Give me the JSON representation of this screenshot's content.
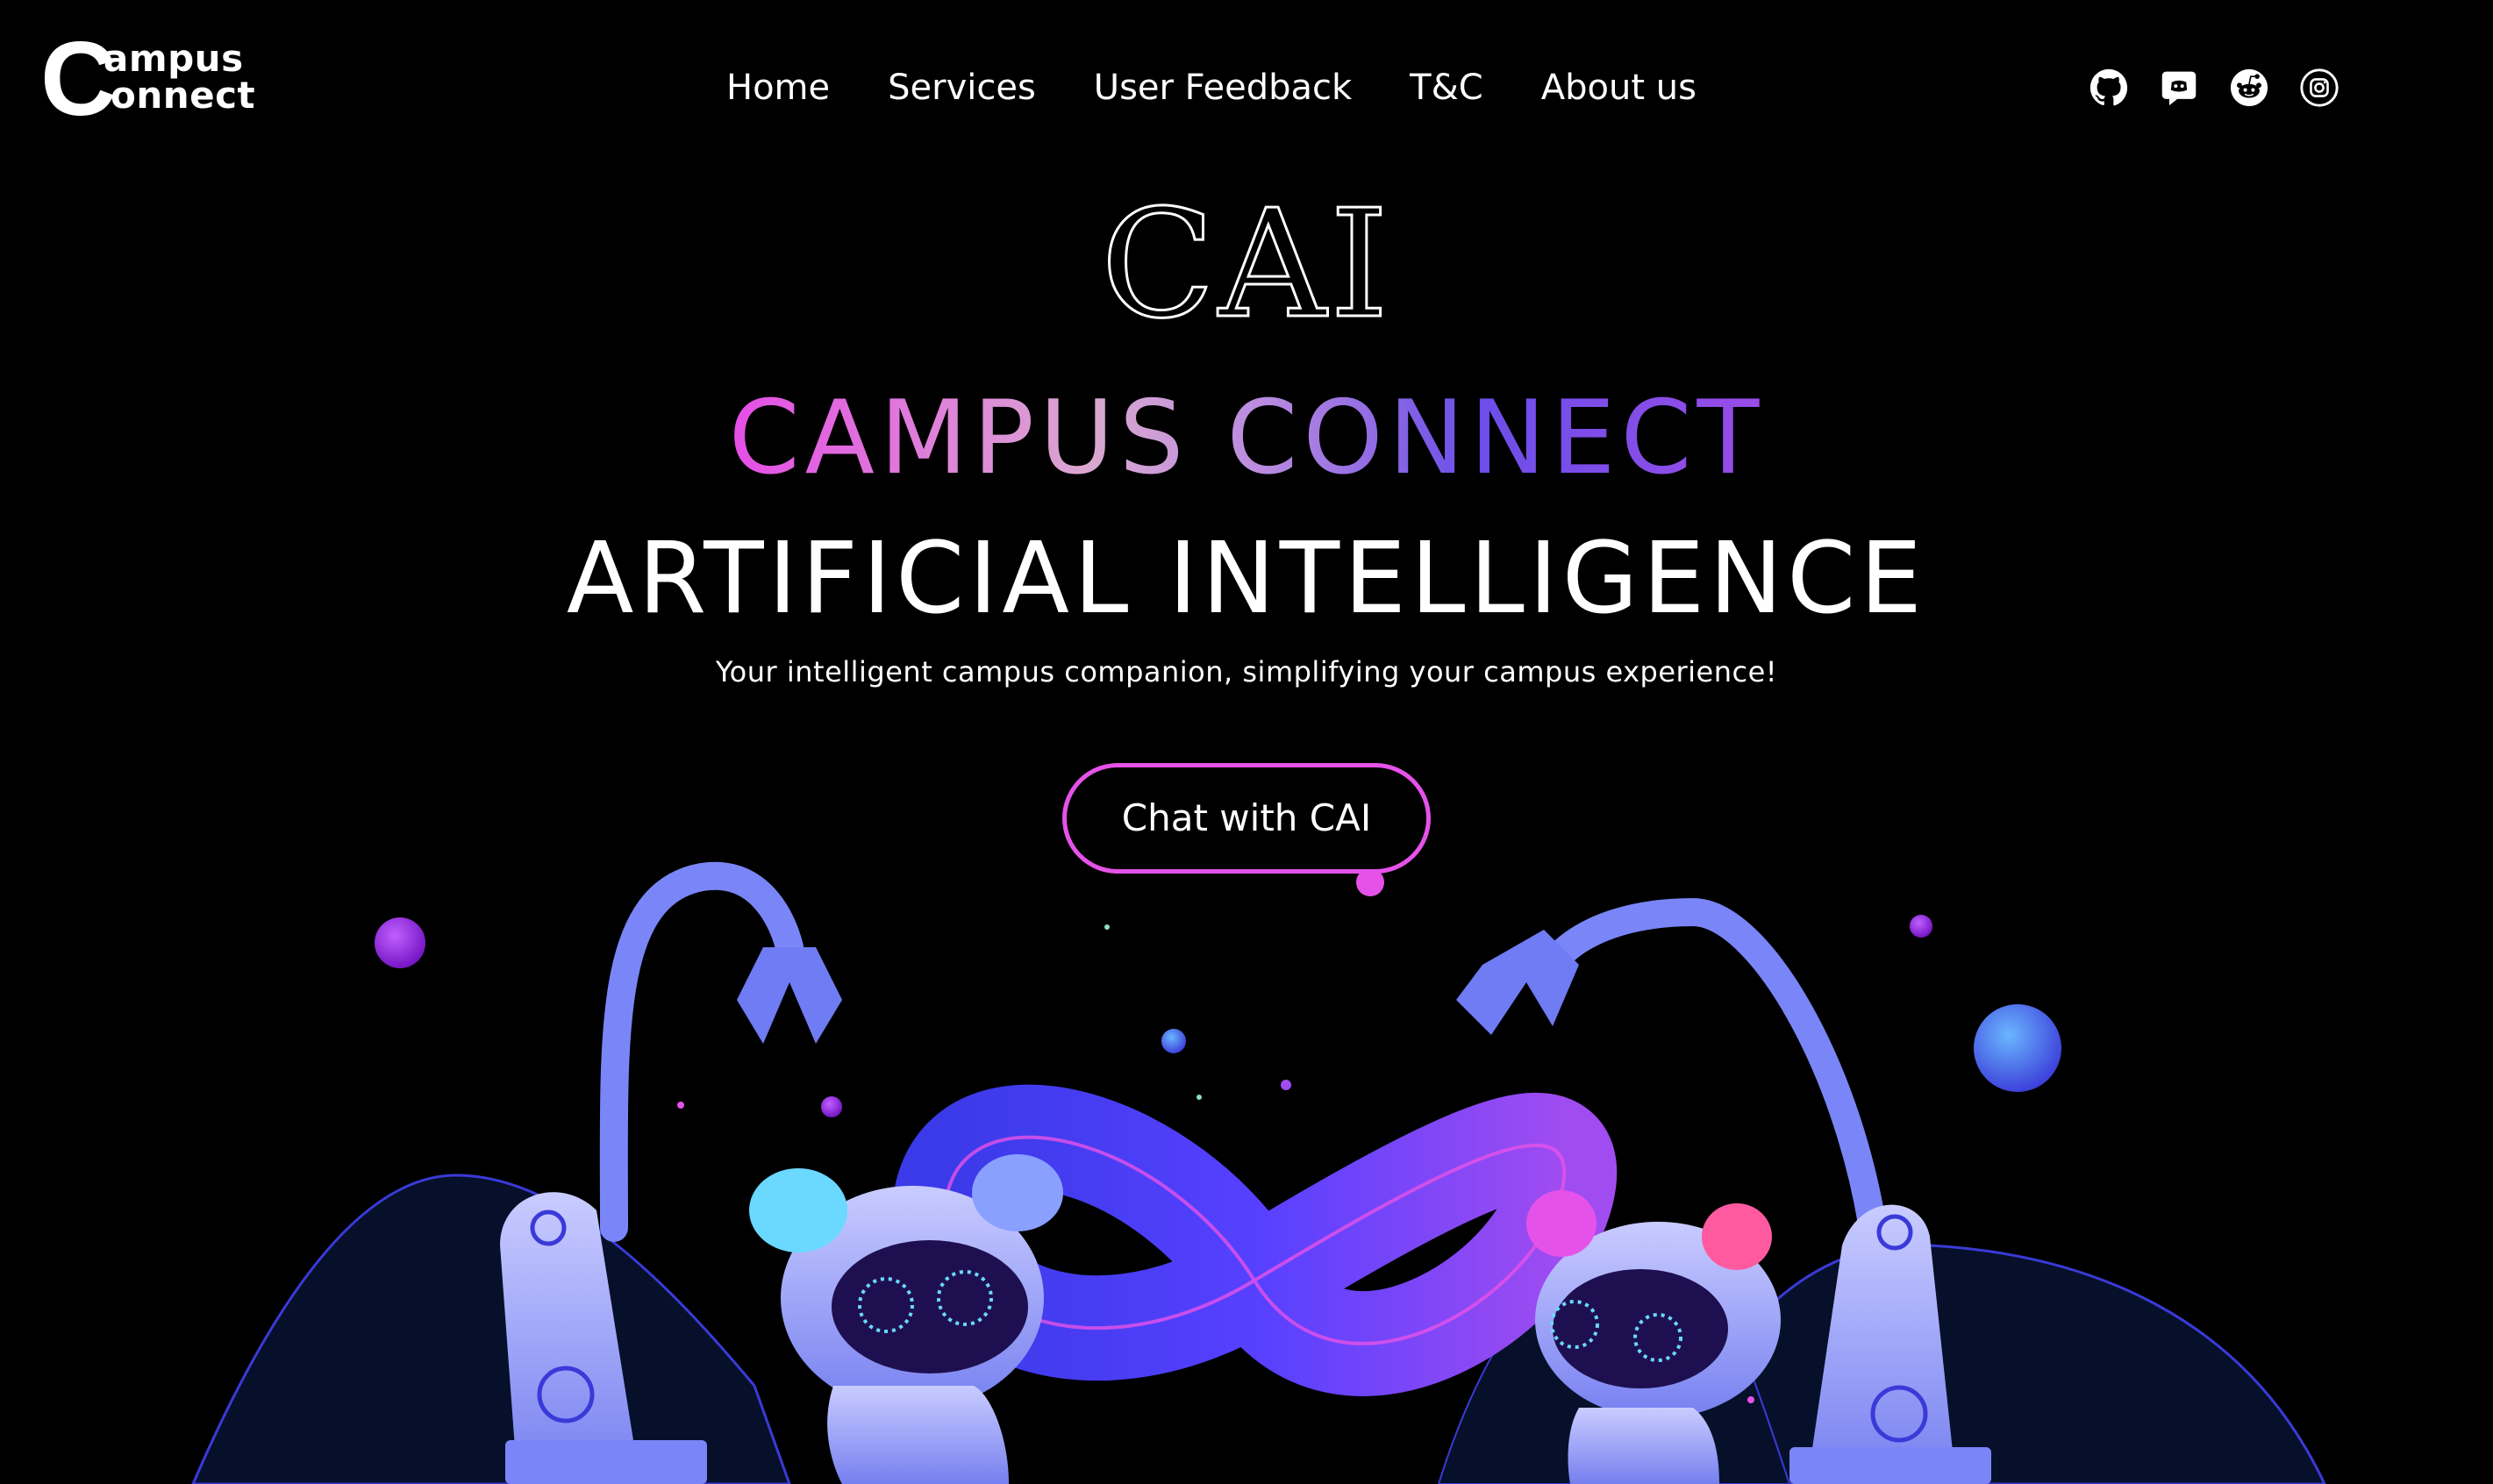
{
  "header": {
    "logo": {
      "big_letter": "C",
      "line1": "ampus",
      "line2": "onnect"
    },
    "nav": [
      "Home",
      "Services",
      "User Feedback",
      "T&C",
      "About us"
    ],
    "socials": [
      "github-icon",
      "discord-icon",
      "reddit-icon",
      "instagram-icon"
    ]
  },
  "hero": {
    "logo_text": "CAI",
    "title_gradient": "CAMPUS CONNECT",
    "subtitle": "ARTIFICIAL INTELLIGENCE",
    "tagline": "Your intelligent campus companion, simplifying your campus experience!",
    "cta_label": "Chat with CAI"
  },
  "colors": {
    "background": "#000000",
    "accent_pink": "#e552e9",
    "accent_purple": "#6a4ee8",
    "robot_blue": "#7d8bff"
  }
}
